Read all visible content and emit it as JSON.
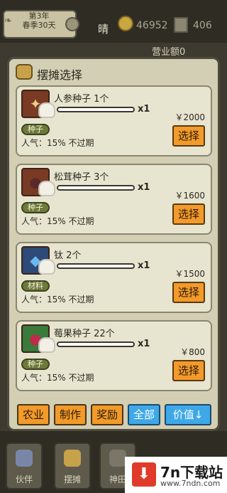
{
  "status_bar": {
    "season_line1": "第3年",
    "season_line2": "春季30天",
    "weather": "晴",
    "coins": "46952",
    "item_count": "406",
    "revenue_label": "营业额0"
  },
  "dialog": {
    "title": "摆摊选择",
    "items": [
      {
        "name": "人参种子 1个",
        "multiplier": "x1",
        "price": "￥2000",
        "tag": "种子",
        "popularity": "人气：15%  不过期",
        "select_label": "选择",
        "icon": "ginseng-seed-icon",
        "glyph": "✦",
        "glyph_color": "#e8d088",
        "thumb_bg": "#7a3a24"
      },
      {
        "name": "松茸种子 3个",
        "multiplier": "x1",
        "price": "￥1600",
        "tag": "种子",
        "popularity": "人气：15%  不过期",
        "select_label": "选择",
        "icon": "matsutake-seed-icon",
        "glyph": "●",
        "glyph_color": "#5a2a2a",
        "thumb_bg": "#7a3a24"
      },
      {
        "name": "钛 2个",
        "multiplier": "x1",
        "price": "￥1500",
        "tag": "材料",
        "popularity": "人气：15%  不过期",
        "select_label": "选择",
        "icon": "titanium-crystal-icon",
        "glyph": "◆",
        "glyph_color": "#6ab8f0",
        "thumb_bg": "#2e4a78"
      },
      {
        "name": "莓果种子 22个",
        "multiplier": "x1",
        "price": "￥800",
        "tag": "种子",
        "popularity": "人气：15%  不过期",
        "select_label": "选择",
        "icon": "berry-seed-icon",
        "glyph": "●",
        "glyph_color": "#c02a4a",
        "thumb_bg": "#3a7a3a"
      }
    ]
  },
  "filters": [
    {
      "label": "农业",
      "active": false
    },
    {
      "label": "制作",
      "active": false
    },
    {
      "label": "奖励",
      "active": false
    },
    {
      "label": "全部",
      "active": true
    },
    {
      "label": "价值↓",
      "active": true
    }
  ],
  "bottom_nav": [
    {
      "label": "伙伴",
      "icon": "partner-icon"
    },
    {
      "label": "摆摊",
      "icon": "stall-icon"
    },
    {
      "label": "神田",
      "icon": "field-icon"
    }
  ],
  "watermark": {
    "text": "7n下载站",
    "url": "www.7ndn.com"
  },
  "colors": {
    "accent_orange": "#f29a2a",
    "accent_blue": "#3ea8e8",
    "tag_green": "#6f7a3a",
    "panel": "#d3cfb4"
  }
}
